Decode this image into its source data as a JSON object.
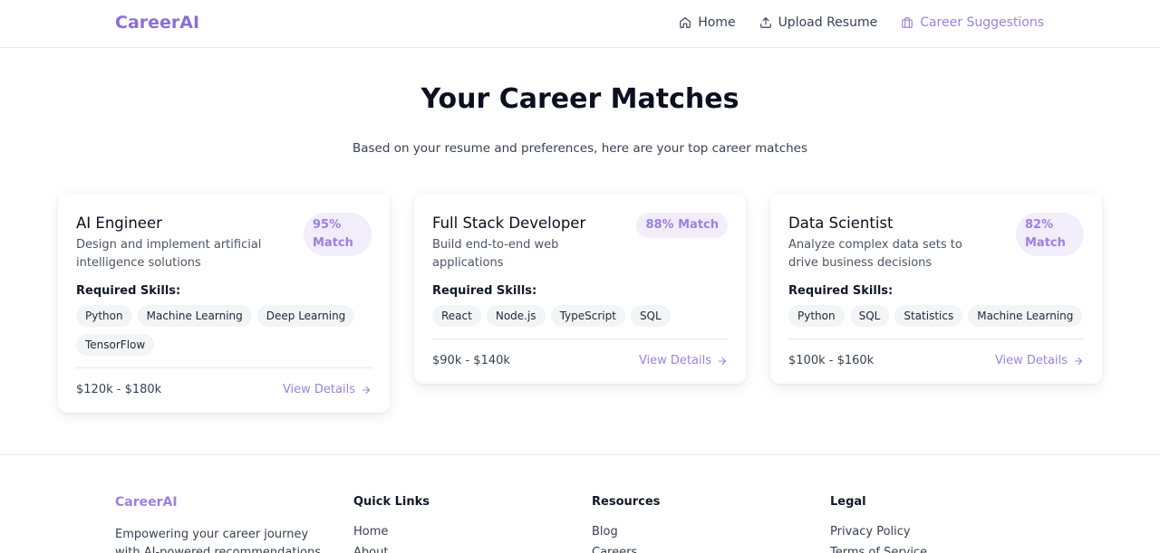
{
  "header": {
    "logo": "CareerAI",
    "nav": [
      {
        "label": "Home",
        "icon": "home-icon"
      },
      {
        "label": "Upload Resume",
        "icon": "upload-icon"
      },
      {
        "label": "Career Suggestions",
        "icon": "briefcase-icon",
        "active": true
      }
    ]
  },
  "hero": {
    "title": "Your Career Matches",
    "subtitle": "Based on your resume and preferences, here are your top career matches"
  },
  "skills_label": "Required Skills:",
  "view_details_label": "View Details",
  "cards": [
    {
      "title": "AI Engineer",
      "description": "Design and implement artificial intelligence solutions",
      "match": "95% Match",
      "skills": [
        "Python",
        "Machine Learning",
        "Deep Learning",
        "TensorFlow"
      ],
      "salary": "$120k - $180k"
    },
    {
      "title": "Full Stack Developer",
      "description": "Build end-to-end web applications",
      "match": "88% Match",
      "skills": [
        "React",
        "Node.js",
        "TypeScript",
        "SQL"
      ],
      "salary": "$90k - $140k"
    },
    {
      "title": "Data Scientist",
      "description": "Analyze complex data sets to drive business decisions",
      "match": "82% Match",
      "skills": [
        "Python",
        "SQL",
        "Statistics",
        "Machine Learning"
      ],
      "salary": "$100k - $160k"
    }
  ],
  "footer": {
    "brand": "CareerAI",
    "tagline": "Empowering your career journey with AI-powered recommendations",
    "quick_links": {
      "heading": "Quick Links",
      "items": [
        "Home",
        "About"
      ]
    },
    "resources": {
      "heading": "Resources",
      "items": [
        "Blog",
        "Careers"
      ]
    },
    "legal": {
      "heading": "Legal",
      "items": [
        "Privacy Policy",
        "Terms of Service"
      ]
    }
  },
  "colors": {
    "accent": "#9b82dc",
    "logo": "#8b6fd6",
    "badge_bg": "#f1edfb",
    "chip_bg": "#f3f4f6"
  }
}
